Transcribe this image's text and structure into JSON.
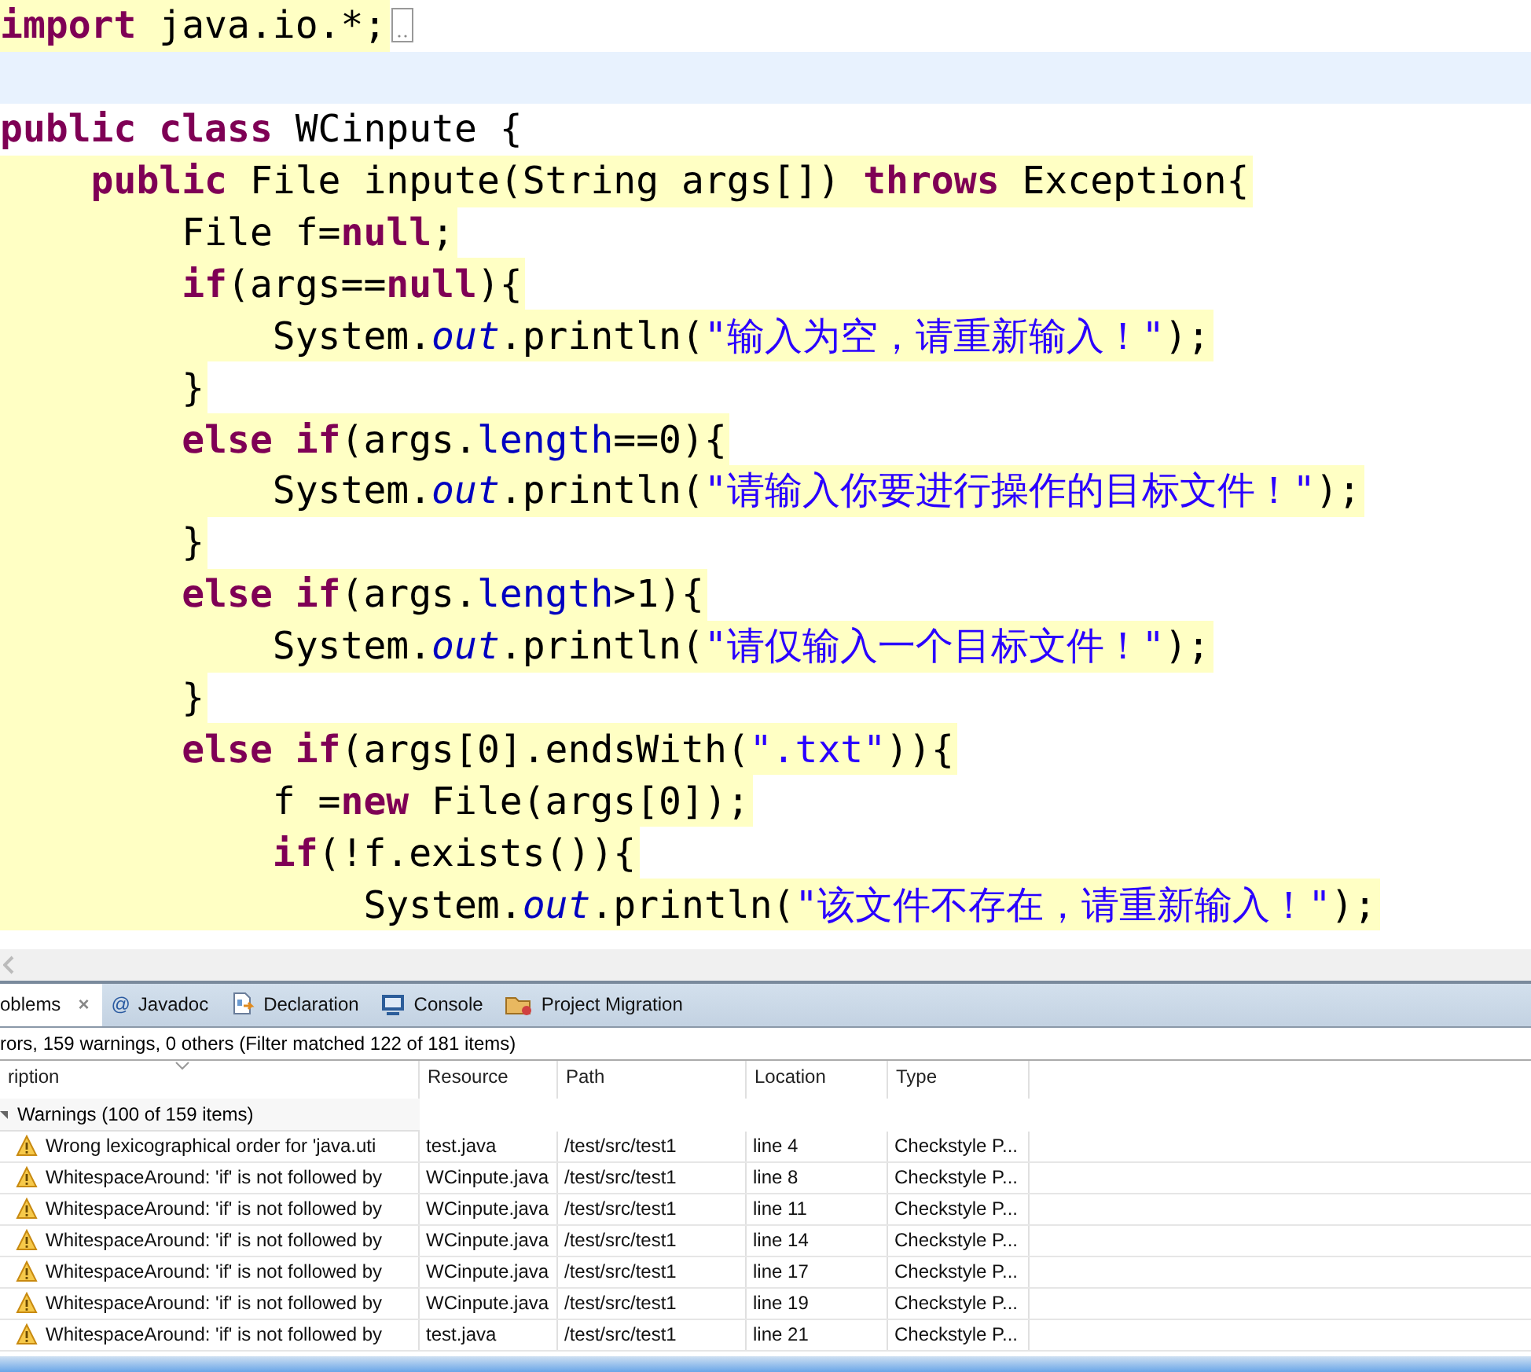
{
  "editor": {
    "lines": [
      {
        "highlighted": true,
        "current": false,
        "folded": true,
        "tokens": [
          {
            "kind": "kw",
            "t": "import"
          },
          {
            "kind": "plain",
            "t": " java.io.*;"
          }
        ]
      },
      {
        "highlighted": false,
        "current": true,
        "folded": false
      },
      {
        "highlighted": false,
        "current": false,
        "folded": false,
        "tokens": [
          {
            "kind": "kw",
            "t": "public class"
          },
          {
            "kind": "plain",
            "t": " WCinpute {"
          }
        ]
      },
      {
        "highlighted": true,
        "current": false,
        "folded": false,
        "tokens": [
          {
            "kind": "kw",
            "t": "    public"
          },
          {
            "kind": "plain",
            "t": " File inpute(String args[]) "
          },
          {
            "kind": "kw",
            "t": "throws"
          },
          {
            "kind": "plain",
            "t": " Exception{"
          }
        ]
      },
      {
        "highlighted": true,
        "current": false,
        "folded": false,
        "tokens": [
          {
            "kind": "plain",
            "t": "        File f="
          },
          {
            "kind": "kw",
            "t": "null"
          },
          {
            "kind": "plain",
            "t": ";"
          }
        ]
      },
      {
        "highlighted": true,
        "current": false,
        "folded": false,
        "tokens": [
          {
            "kind": "kw",
            "t": "        if"
          },
          {
            "kind": "plain",
            "t": "(args=="
          },
          {
            "kind": "kw",
            "t": "null"
          },
          {
            "kind": "plain",
            "t": "){"
          }
        ]
      },
      {
        "highlighted": true,
        "current": false,
        "folded": false,
        "tokens": [
          {
            "kind": "plain",
            "t": "            System."
          },
          {
            "kind": "static",
            "t": "out"
          },
          {
            "kind": "plain",
            "t": ".println("
          },
          {
            "kind": "str",
            "t": "\"输入为空，请重新输入！\""
          },
          {
            "kind": "plain",
            "t": ");"
          }
        ]
      },
      {
        "highlighted": true,
        "current": false,
        "folded": false,
        "tokens": [
          {
            "kind": "plain",
            "t": "        }"
          }
        ]
      },
      {
        "highlighted": true,
        "current": false,
        "folded": false,
        "tokens": [
          {
            "kind": "kw",
            "t": "        else if"
          },
          {
            "kind": "plain",
            "t": "(args."
          },
          {
            "kind": "field",
            "t": "length"
          },
          {
            "kind": "plain",
            "t": "==0){"
          }
        ]
      },
      {
        "highlighted": true,
        "current": false,
        "folded": false,
        "tokens": [
          {
            "kind": "plain",
            "t": "            System."
          },
          {
            "kind": "static",
            "t": "out"
          },
          {
            "kind": "plain",
            "t": ".println("
          },
          {
            "kind": "str",
            "t": "\"请输入你要进行操作的目标文件！\""
          },
          {
            "kind": "plain",
            "t": ");"
          }
        ]
      },
      {
        "highlighted": true,
        "current": false,
        "folded": false,
        "tokens": [
          {
            "kind": "plain",
            "t": "        }"
          }
        ]
      },
      {
        "highlighted": true,
        "current": false,
        "folded": false,
        "tokens": [
          {
            "kind": "kw",
            "t": "        else if"
          },
          {
            "kind": "plain",
            "t": "(args."
          },
          {
            "kind": "field",
            "t": "length"
          },
          {
            "kind": "plain",
            "t": ">1){"
          }
        ]
      },
      {
        "highlighted": true,
        "current": false,
        "folded": false,
        "tokens": [
          {
            "kind": "plain",
            "t": "            System."
          },
          {
            "kind": "static",
            "t": "out"
          },
          {
            "kind": "plain",
            "t": ".println("
          },
          {
            "kind": "str",
            "t": "\"请仅输入一个目标文件！\""
          },
          {
            "kind": "plain",
            "t": ");"
          }
        ]
      },
      {
        "highlighted": true,
        "current": false,
        "folded": false,
        "tokens": [
          {
            "kind": "plain",
            "t": "        }"
          }
        ]
      },
      {
        "highlighted": true,
        "current": false,
        "folded": false,
        "tokens": [
          {
            "kind": "kw",
            "t": "        else if"
          },
          {
            "kind": "plain",
            "t": "(args[0].endsWith("
          },
          {
            "kind": "str",
            "t": "\".txt\""
          },
          {
            "kind": "plain",
            "t": ")){"
          }
        ]
      },
      {
        "highlighted": true,
        "current": false,
        "folded": false,
        "tokens": [
          {
            "kind": "plain",
            "t": "            f ="
          },
          {
            "kind": "kw",
            "t": "new"
          },
          {
            "kind": "plain",
            "t": " File(args[0]);"
          }
        ]
      },
      {
        "highlighted": true,
        "current": false,
        "folded": false,
        "tokens": [
          {
            "kind": "kw",
            "t": "            if"
          },
          {
            "kind": "plain",
            "t": "(!f.exists()){"
          }
        ]
      },
      {
        "highlighted": true,
        "current": false,
        "folded": false,
        "tokens": [
          {
            "kind": "plain",
            "t": "                System."
          },
          {
            "kind": "static",
            "t": "out"
          },
          {
            "kind": "plain",
            "t": ".println("
          },
          {
            "kind": "str",
            "t": "\"该文件不存在，请重新输入！\""
          },
          {
            "kind": "plain",
            "t": ");"
          }
        ]
      }
    ]
  },
  "panel": {
    "tabs": [
      {
        "label": "oblems",
        "selected": true,
        "close": "×"
      },
      {
        "label": "Javadoc",
        "selected": false,
        "icon_text": "@"
      },
      {
        "label": "Declaration",
        "selected": false
      },
      {
        "label": "Console",
        "selected": false
      },
      {
        "label": "Project Migration",
        "selected": false
      }
    ],
    "summary": "rors, 159 warnings, 0 others (Filter matched 122 of 181 items)",
    "table": {
      "columns": [
        "ription",
        "Resource",
        "Path",
        "Location",
        "Type"
      ],
      "group": {
        "label": "Warnings (100 of 159 items)",
        "expanded": true
      },
      "rows": [
        [
          "Wrong lexicographical order for 'java.uti",
          "test.java",
          "/test/src/test1",
          "line 4",
          "Checkstyle P..."
        ],
        [
          "WhitespaceAround: 'if' is not followed by",
          "WCinpute.java",
          "/test/src/test1",
          "line 8",
          "Checkstyle P..."
        ],
        [
          "WhitespaceAround: 'if' is not followed by",
          "WCinpute.java",
          "/test/src/test1",
          "line 11",
          "Checkstyle P..."
        ],
        [
          "WhitespaceAround: 'if' is not followed by",
          "WCinpute.java",
          "/test/src/test1",
          "line 14",
          "Checkstyle P..."
        ],
        [
          "WhitespaceAround: 'if' is not followed by",
          "WCinpute.java",
          "/test/src/test1",
          "line 17",
          "Checkstyle P..."
        ],
        [
          "WhitespaceAround: 'if' is not followed by",
          "WCinpute.java",
          "/test/src/test1",
          "line 19",
          "Checkstyle P..."
        ],
        [
          "WhitespaceAround: 'if' is not followed by",
          "test.java",
          "/test/src/test1",
          "line 21",
          "Checkstyle P..."
        ]
      ]
    }
  }
}
